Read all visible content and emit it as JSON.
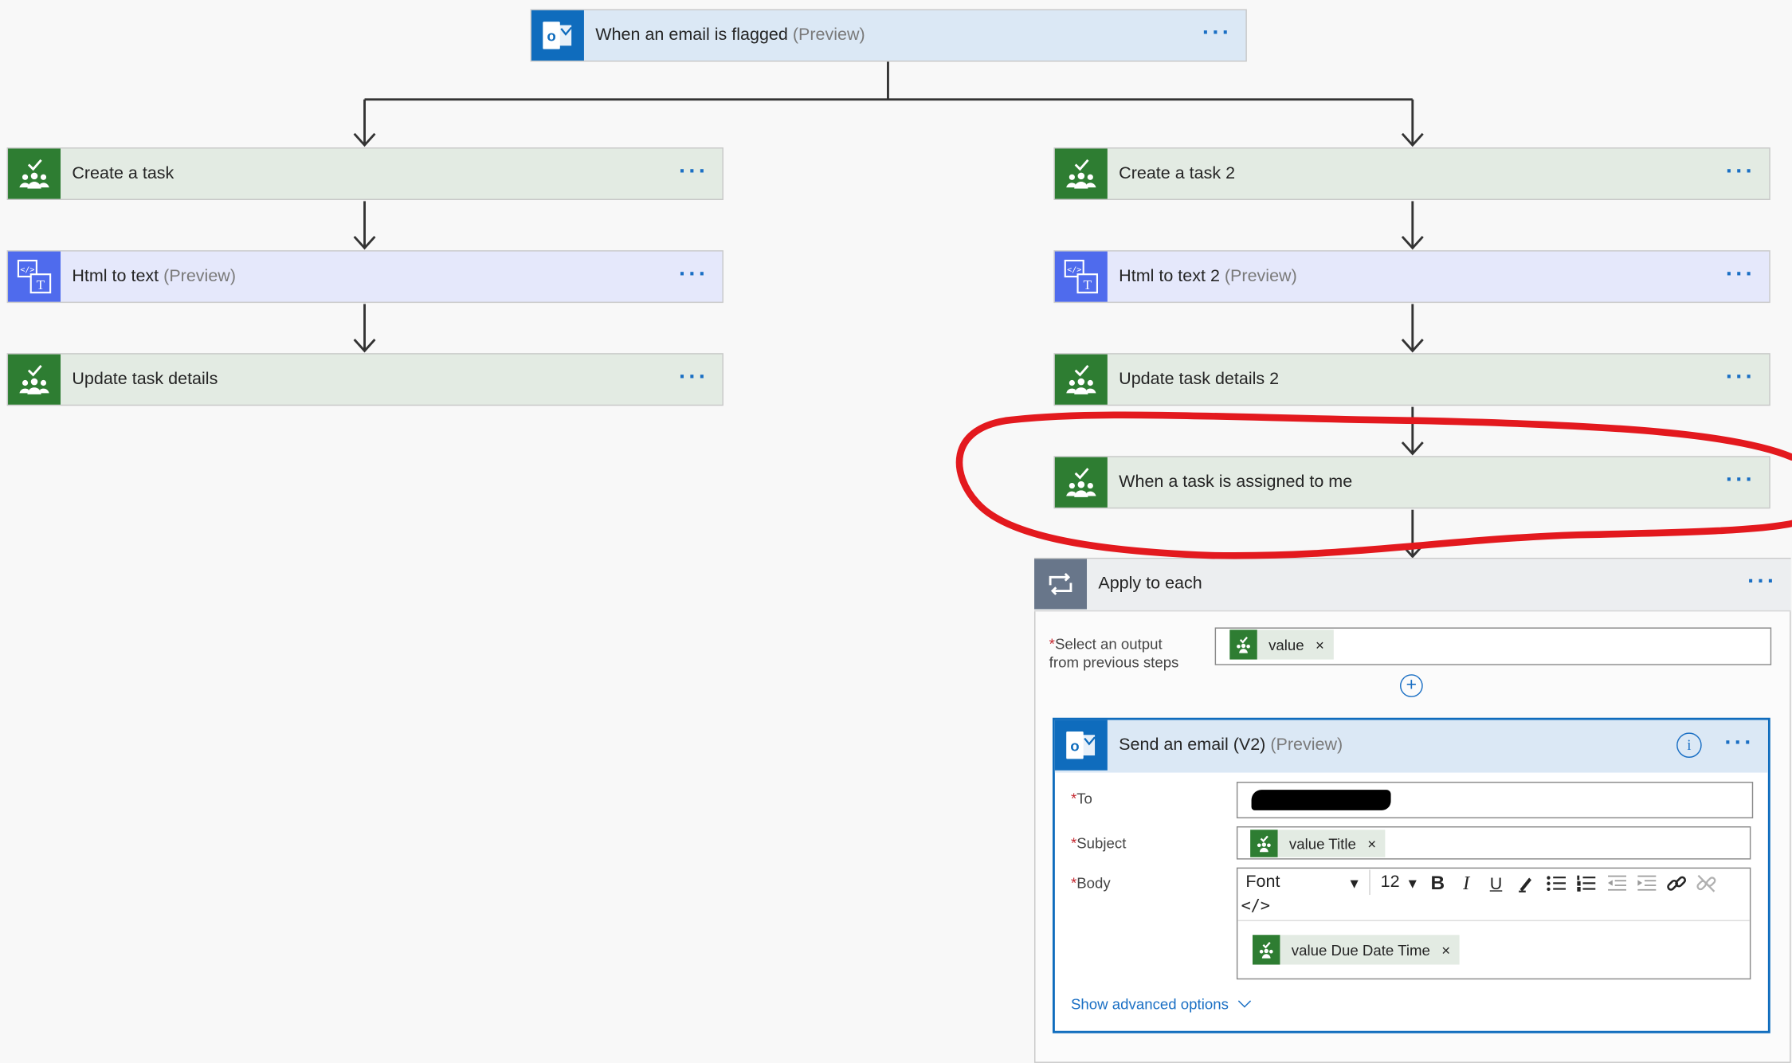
{
  "trigger": {
    "title": "When an email is flagged",
    "suffix": "(Preview)",
    "menu": "···"
  },
  "left_branch": {
    "create_task": {
      "title": "Create a task",
      "menu": "···"
    },
    "html_to_text": {
      "title": "Html to text",
      "suffix": "(Preview)",
      "menu": "···"
    },
    "update_task": {
      "title": "Update task details",
      "menu": "···"
    }
  },
  "right_branch": {
    "create_task": {
      "title": "Create a task 2",
      "menu": "···"
    },
    "html_to_text": {
      "title": "Html to text 2",
      "suffix": "(Preview)",
      "menu": "···"
    },
    "update_task": {
      "title": "Update task details 2",
      "menu": "···"
    },
    "task_assigned": {
      "title": "When a task is assigned to me",
      "menu": "···"
    }
  },
  "apply_to_each": {
    "title": "Apply to each",
    "menu": "···",
    "select_output_label_line1": "Select an output",
    "select_output_label_line2": "from previous steps",
    "required_mark": "*",
    "output_token": "value",
    "token_close": "×"
  },
  "send_email": {
    "title": "Send an email (V2)",
    "suffix": "(Preview)",
    "menu": "···",
    "to_label": "To",
    "subject_label": "Subject",
    "body_label": "Body",
    "subject_token": "value Title",
    "body_token": "value Due Date Time",
    "font_select": "Font",
    "font_size": "12",
    "code_view": "</>",
    "show_advanced": "Show advanced options"
  },
  "colors": {
    "planner_green": "#2e7d32",
    "outlook_blue": "#0f6cbd",
    "html_purple": "#4f6bed",
    "loop_grey": "#68768a",
    "annotation_red": "#e3191e",
    "link_blue": "#1a6fc4"
  },
  "icons": {
    "planner": "planner-icon",
    "outlook": "outlook-icon",
    "html_to_text": "html-to-text-icon",
    "loop": "loop-icon"
  }
}
